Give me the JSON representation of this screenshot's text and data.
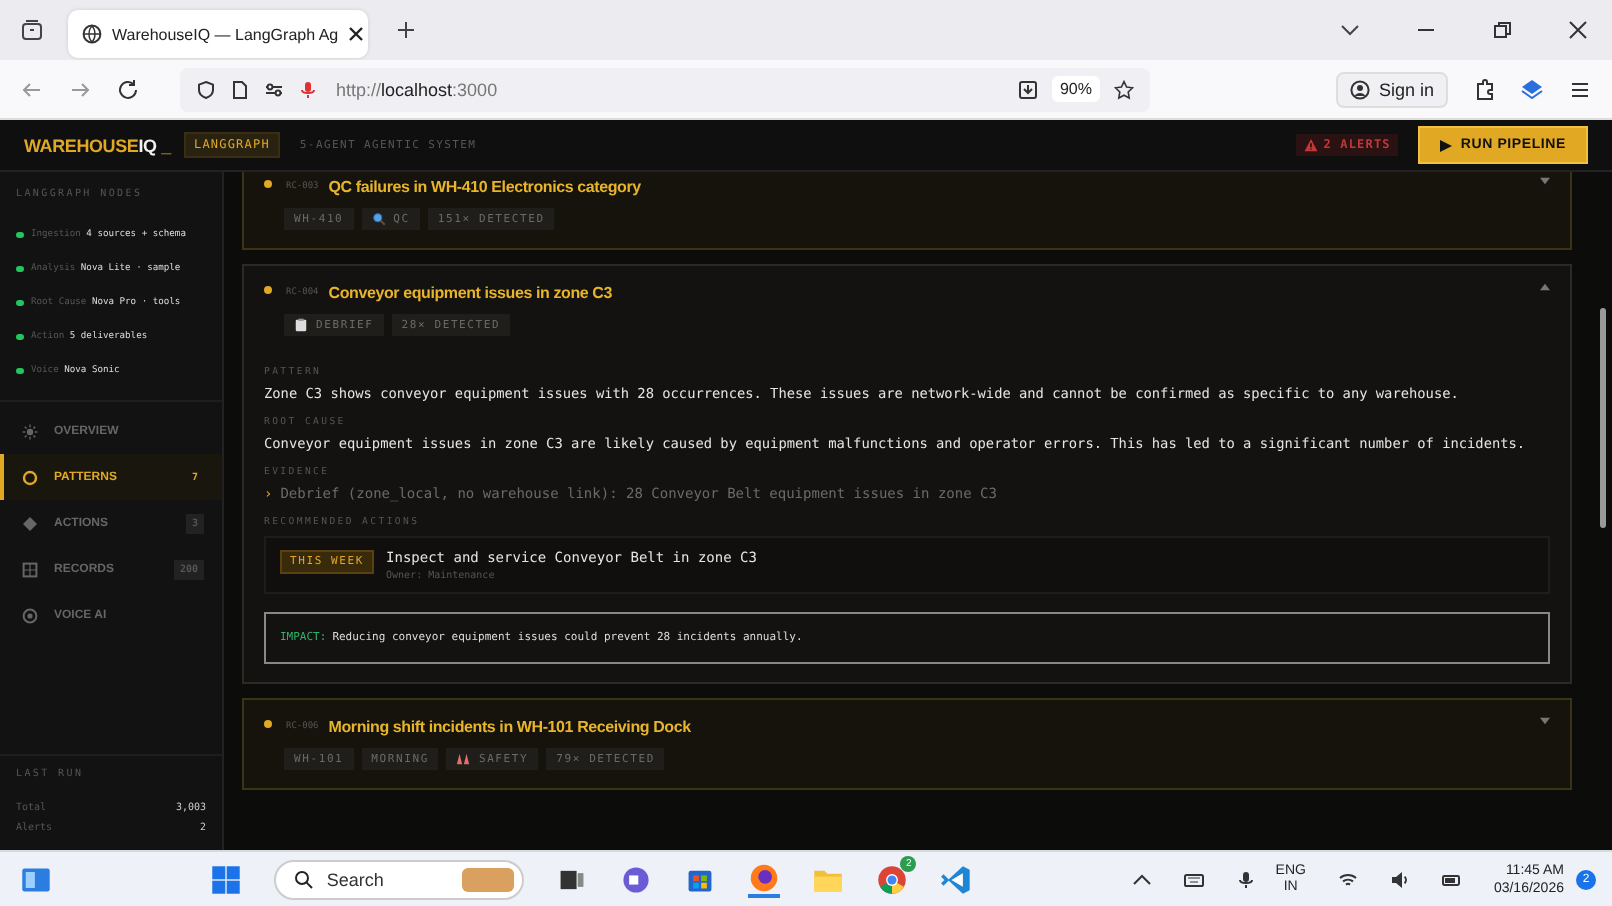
{
  "browser": {
    "tab": {
      "title": "WarehouseIQ — LangGraph Ag"
    },
    "url": {
      "scheme": "http://",
      "host": "localhost",
      "port": ":3000"
    },
    "zoom": "90%",
    "sign_in": "Sign in"
  },
  "header": {
    "logo_main": "WAREHOUSE",
    "logo_accent": "IQ",
    "logo_cursor": "_",
    "badge": "LANGGRAPH",
    "subtitle": "5-AGENT AGENTIC SYSTEM",
    "alerts": "2 ALERTS",
    "run_button": "RUN PIPELINE"
  },
  "sidebar": {
    "nodes_title": "LANGGRAPH NODES",
    "nodes": [
      {
        "name": "Ingestion",
        "detail": "4 sources + schema",
        "color": "#22c55e"
      },
      {
        "name": "Analysis",
        "detail": "Nova Lite · sample",
        "color": "#22c55e"
      },
      {
        "name": "Root Cause",
        "detail": "Nova Pro · tools",
        "color": "#22c55e"
      },
      {
        "name": "Action",
        "detail": "5 deliverables",
        "color": "#22c55e"
      },
      {
        "name": "Voice",
        "detail": "Nova Sonic",
        "color": "#22c55e"
      }
    ],
    "nav": [
      {
        "kind": "overview",
        "label": "OVERVIEW",
        "selected": false
      },
      {
        "kind": "patterns",
        "label": "PATTERNS",
        "count": "7",
        "selected": true
      },
      {
        "kind": "actions",
        "label": "ACTIONS",
        "count": "3",
        "selected": false
      },
      {
        "kind": "records",
        "label": "RECORDS",
        "count": "200",
        "selected": false
      },
      {
        "kind": "voice",
        "label": "VOICE AI",
        "selected": false
      }
    ],
    "last_run_title": "LAST RUN",
    "last_run": [
      {
        "label": "Total",
        "value": "3,003"
      },
      {
        "label": "Alerts",
        "value": "2"
      }
    ]
  },
  "patterns": [
    {
      "id": "RC-003",
      "title": "QC failures in WH-410 Electronics category",
      "expanded": false,
      "cut_top": true,
      "tags": [
        {
          "text": "WH-410"
        },
        {
          "kind": "magnifier",
          "text": "QC"
        },
        {
          "text": "151× DETECTED"
        }
      ]
    },
    {
      "id": "RC-004",
      "title": "Conveyor equipment issues in zone C3",
      "expanded": true,
      "tags": [
        {
          "kind": "clipboard",
          "text": "DEBRIEF"
        },
        {
          "text": "28× DETECTED"
        }
      ],
      "pattern_label": "PATTERN",
      "pattern": "Zone C3 shows conveyor equipment issues with 28 occurrences. These issues are network-wide and cannot be confirmed as specific to any warehouse.",
      "root_cause_label": "ROOT CAUSE",
      "root_cause": "Conveyor equipment issues in zone C3 are likely caused by equipment malfunctions and operator errors. This has led to a significant number of incidents.",
      "evidence_label": "EVIDENCE",
      "evidence": [
        {
          "marker": "›",
          "text": "Debrief (zone_local, no warehouse link): 28 Conveyor Belt equipment issues in zone C3"
        }
      ],
      "actions_label": "RECOMMENDED ACTIONS",
      "actions": [
        {
          "when": "THIS WEEK",
          "text": "Inspect and service Conveyor Belt in zone C3",
          "owner": "Owner: Maintenance"
        }
      ],
      "impact_label": "IMPACT:",
      "impact": "Reducing conveyor equipment issues could prevent 28 incidents annually."
    },
    {
      "id": "RC-006",
      "title": "Morning shift incidents in WH-101 Receiving Dock",
      "expanded": false,
      "tags": [
        {
          "text": "WH-101"
        },
        {
          "text": "MORNING"
        },
        {
          "kind": "cones",
          "text": "SAFETY"
        },
        {
          "text": "79× DETECTED"
        }
      ]
    }
  ],
  "taskbar": {
    "search": "Search",
    "chrome_badge": "2",
    "lang_top": "ENG",
    "lang_bottom": "IN",
    "time": "11:45 AM",
    "date": "03/16/2026",
    "notifications": "2"
  }
}
